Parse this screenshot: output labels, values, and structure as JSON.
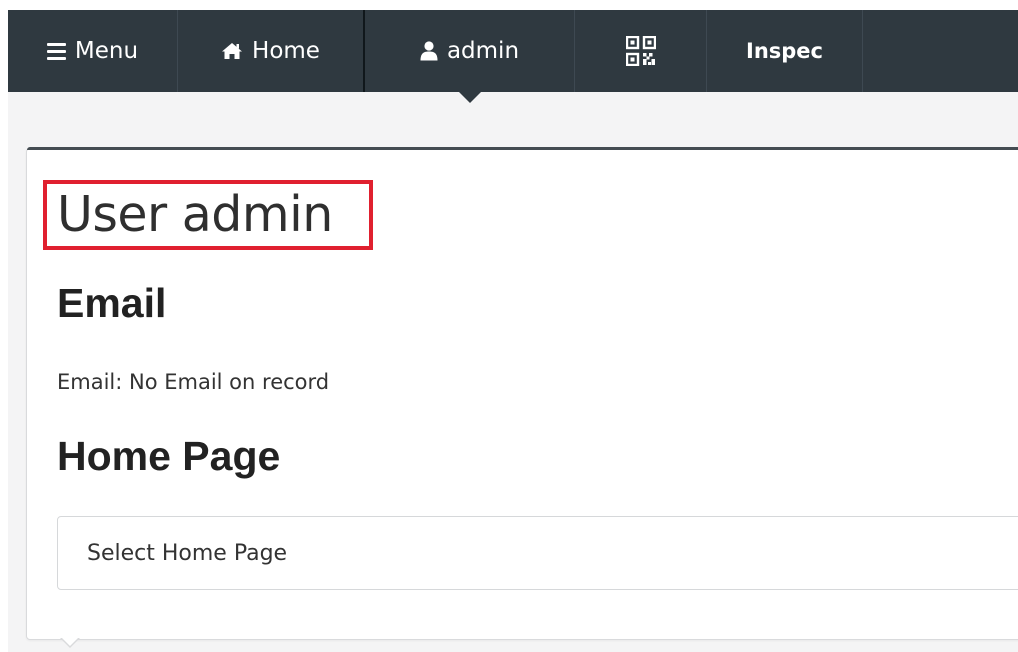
{
  "navbar": {
    "background": "#2f3940",
    "items": [
      {
        "label": "Menu",
        "icon": "menu-icon"
      },
      {
        "label": "Home",
        "icon": "home-icon"
      },
      {
        "label": "admin",
        "icon": "user-icon",
        "active": true
      },
      {
        "label": "",
        "icon": "qr-code-icon"
      },
      {
        "label": "Inspec",
        "icon": ""
      }
    ]
  },
  "page": {
    "title": "User admin",
    "email_heading": "Email",
    "email_text": "Email: No Email on record",
    "home_page_heading": "Home Page",
    "home_page_select": "Select Home Page"
  },
  "colors": {
    "highlight": "#e0202f"
  }
}
